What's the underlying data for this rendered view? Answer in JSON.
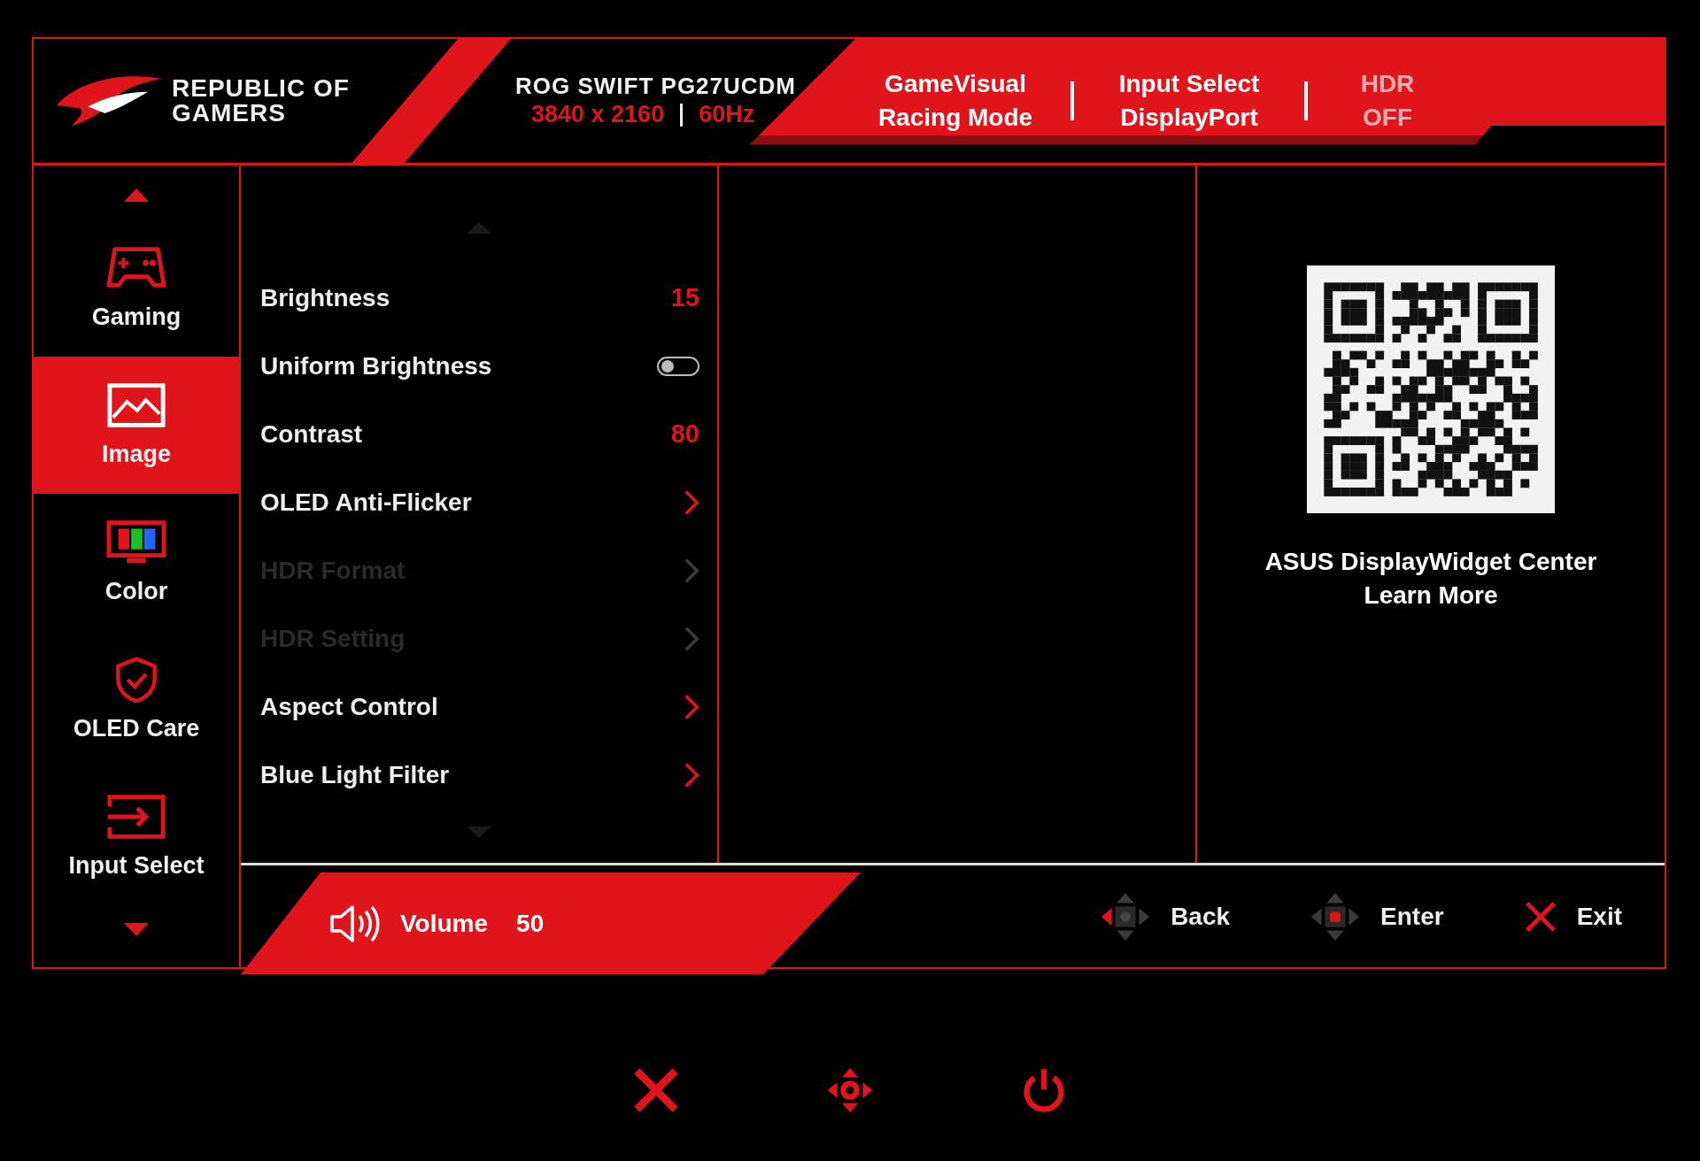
{
  "header": {
    "logo_lines": [
      "REPUBLIC OF",
      "GAMERS"
    ],
    "model": "ROG SWIFT PG27UCDM",
    "resolution": "3840 x 2160",
    "refresh": "60Hz",
    "status": [
      {
        "label": "GameVisual",
        "value": "Racing Mode",
        "dimmed": false
      },
      {
        "label": "Input Select",
        "value": "DisplayPort",
        "dimmed": false
      },
      {
        "label": "HDR",
        "value": "OFF",
        "dimmed": true
      }
    ]
  },
  "sidebar": {
    "items": [
      {
        "kind": "gaming",
        "label": "Gaming",
        "selected": false
      },
      {
        "kind": "image",
        "label": "Image",
        "selected": true
      },
      {
        "kind": "color",
        "label": "Color",
        "selected": false
      },
      {
        "kind": "care",
        "label": "OLED Care",
        "selected": false
      },
      {
        "kind": "input",
        "label": "Input Select",
        "selected": false
      }
    ]
  },
  "menu": {
    "items": [
      {
        "kind": "value",
        "label": "Brightness",
        "value": "15",
        "disabled": false
      },
      {
        "kind": "toggle",
        "label": "Uniform Brightness",
        "on": false,
        "disabled": false
      },
      {
        "kind": "value",
        "label": "Contrast",
        "value": "80",
        "disabled": false
      },
      {
        "kind": "submenu",
        "label": "OLED Anti-Flicker",
        "disabled": false
      },
      {
        "kind": "submenu",
        "label": "HDR Format",
        "disabled": true
      },
      {
        "kind": "submenu",
        "label": "HDR Setting",
        "disabled": true
      },
      {
        "kind": "submenu",
        "label": "Aspect Control",
        "disabled": false
      },
      {
        "kind": "submenu",
        "label": "Blue Light Filter",
        "disabled": false
      }
    ]
  },
  "info": {
    "lines": [
      "ASUS DisplayWidget Center",
      "Learn More"
    ]
  },
  "volume": {
    "label": "Volume",
    "value": "50"
  },
  "hints": [
    {
      "kind": "back",
      "label": "Back"
    },
    {
      "kind": "enter",
      "label": "Enter"
    },
    {
      "kind": "exit",
      "label": "Exit"
    }
  ]
}
